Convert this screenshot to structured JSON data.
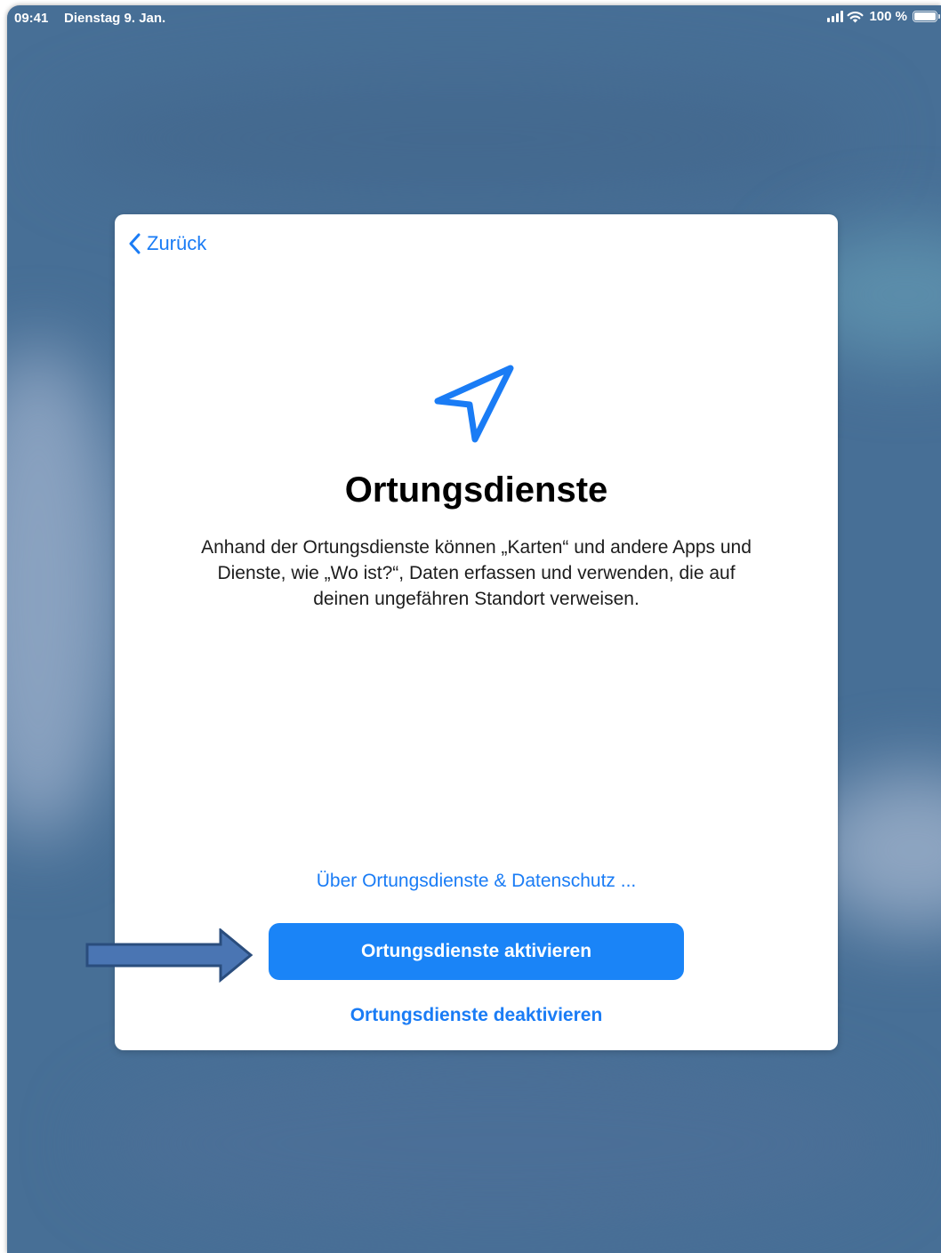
{
  "statusbar": {
    "time": "09:41",
    "date": "Dienstag 9. Jan.",
    "battery": "100 %",
    "battery_level_percent": 100,
    "icons": [
      "signal-icon",
      "wifi-icon",
      "battery-icon"
    ]
  },
  "card": {
    "back_label": "Zurück",
    "icon": "location-arrow-icon",
    "title": "Ortungsdienste",
    "description": "Anhand der Ortungsdienste können „Karten“ und andere Apps und Dienste, wie „Wo ist?“, Daten erfassen und verwenden, die auf deinen ungefähren Standort verweisen.",
    "privacy_link": "Über Ortungsdienste & Datenschutz ...",
    "enable_button": "Ortungsdienste aktivieren",
    "disable_link": "Ortungsdienste deaktivieren"
  },
  "annotation": {
    "icon": "pointer-arrow-icon"
  },
  "colors": {
    "accent": "#1a7cf5",
    "button": "#1a84f7",
    "background": "#476f96",
    "annotation_arrow": "#4a75b3"
  }
}
